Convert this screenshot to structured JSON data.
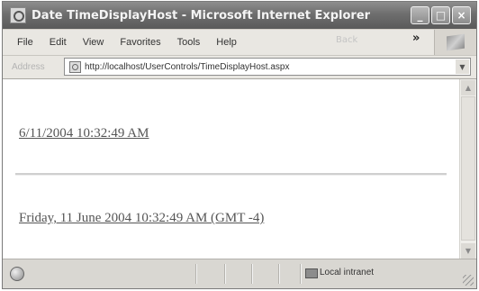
{
  "window": {
    "title": "Date TimeDisplayHost - Microsoft Internet Explorer",
    "caption_buttons": [
      "_",
      "□",
      "×"
    ]
  },
  "menubar": {
    "items": [
      "File",
      "Edit",
      "View",
      "Favorites",
      "Tools",
      "Help"
    ],
    "back_label": "Back",
    "overflow": "»"
  },
  "addressbar": {
    "label": "Address",
    "url": "http://localhost/UserControls/TimeDisplayHost.aspx"
  },
  "content": {
    "short_date": "6/11/2004 10:32:49 AM",
    "long_date": "Friday, 11 June 2004 10:32:49 AM (GMT -4)"
  },
  "statusbar": {
    "zone": "Local intranet"
  },
  "icons": {
    "app": "ie-page-icon",
    "page": "page-icon",
    "status": "globe-icon",
    "zone": "local-intranet-icon"
  }
}
